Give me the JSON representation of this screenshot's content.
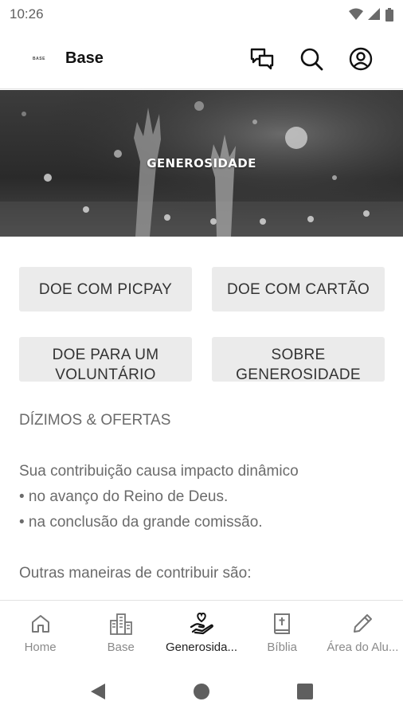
{
  "status_bar": {
    "time": "10:26"
  },
  "app_bar": {
    "logo_text": "BASE",
    "title": "Base",
    "actions": [
      "chat-icon",
      "search-icon",
      "account-icon"
    ]
  },
  "hero": {
    "title": "GENEROSIDADE"
  },
  "buttons": {
    "picpay": "DOE COM PICPAY",
    "cartao": "DOE COM CARTÃO",
    "voluntario_line1": "DOE PARA UM",
    "voluntario_line2": "VOLUNTÁRIO",
    "sobre_line1": "SOBRE",
    "sobre_line2": "GENEROSIDADE"
  },
  "content": {
    "section_title": "DÍZIMOS & OFERTAS",
    "intro": "Sua contribuição causa impacto dinâmico",
    "bullet1": "• no avanço do Reino de Deus.",
    "bullet2": "• na conclusão da grande comissão.",
    "other_ways": "Outras maneiras de contribuir são:"
  },
  "bottom_nav": {
    "home": "Home",
    "base": "Base",
    "generosidade": "Generosida...",
    "biblia": "Bíblia",
    "area_aluno": "Área do Alu..."
  },
  "colors": {
    "active_nav": "#222222",
    "inactive_nav": "#8a8a8a",
    "button_bg": "#ebebeb",
    "body_text": "#6b6b6b"
  }
}
